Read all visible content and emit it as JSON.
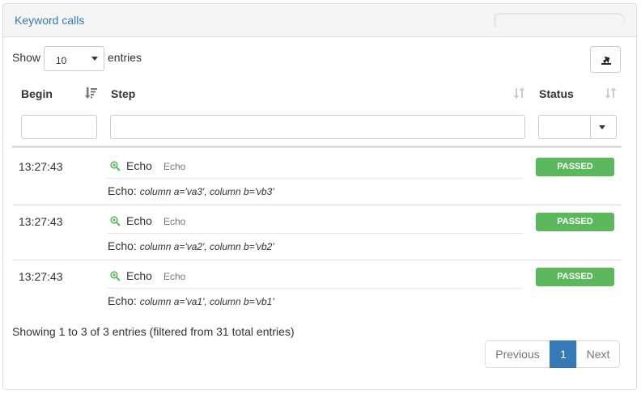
{
  "panel": {
    "title": "Keyword calls",
    "progress": 0.02
  },
  "length": {
    "show_label": "Show",
    "value": "10",
    "entries_label": "entries"
  },
  "columns": {
    "begin": "Begin",
    "step": "Step",
    "status": "Status"
  },
  "rows": [
    {
      "time": "13:27:43",
      "name": "Echo",
      "library": "Echo",
      "args_prefix": "Echo:",
      "args": "column a='va3', column b='vb3'",
      "status": "PASSED"
    },
    {
      "time": "13:27:43",
      "name": "Echo",
      "library": "Echo",
      "args_prefix": "Echo:",
      "args": "column a='va2', column b='vb2'",
      "status": "PASSED"
    },
    {
      "time": "13:27:43",
      "name": "Echo",
      "library": "Echo",
      "args_prefix": "Echo:",
      "args": "column a='va1', column b='vb1'",
      "status": "PASSED"
    }
  ],
  "info": "Showing 1 to 3 of 3 entries (filtered from 31 total entries)",
  "pagination": {
    "previous": "Previous",
    "current": "1",
    "next": "Next"
  },
  "colors": {
    "accent": "#337ab7",
    "passed": "#5cb85c",
    "zoom_icon": "#5cb85c"
  },
  "icons": {
    "export": "export-icon",
    "sort_begin": "sort-amount-desc-icon",
    "sort_step": "sort-icon",
    "sort_status": "sort-icon",
    "row_zoom": "zoom-in-icon"
  }
}
